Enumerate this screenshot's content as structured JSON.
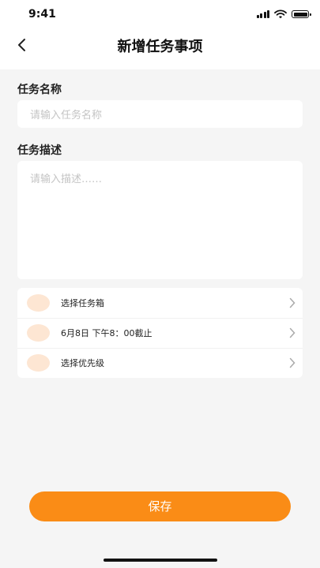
{
  "status_bar": {
    "time": "9:41",
    "icons": [
      "signal-icon",
      "wifi-icon",
      "battery-icon"
    ]
  },
  "nav": {
    "title": "新增任务事项",
    "back_icon": "chevron-left-icon"
  },
  "form": {
    "name_label": "任务名称",
    "name_placeholder": "请输入任务名称",
    "desc_label": "任务描述",
    "desc_placeholder": "请输入描述……"
  },
  "options": [
    {
      "label": "选择任务箱",
      "icon": "chevron-right-icon"
    },
    {
      "label": "6月8日 下午8：00截止",
      "icon": "chevron-right-icon"
    },
    {
      "label": "选择优先级",
      "icon": "chevron-right-icon"
    }
  ],
  "save_label": "保存",
  "colors": {
    "accent": "#fa8c16",
    "option_circle": "#fde6d3",
    "background": "#f5f5f5"
  }
}
